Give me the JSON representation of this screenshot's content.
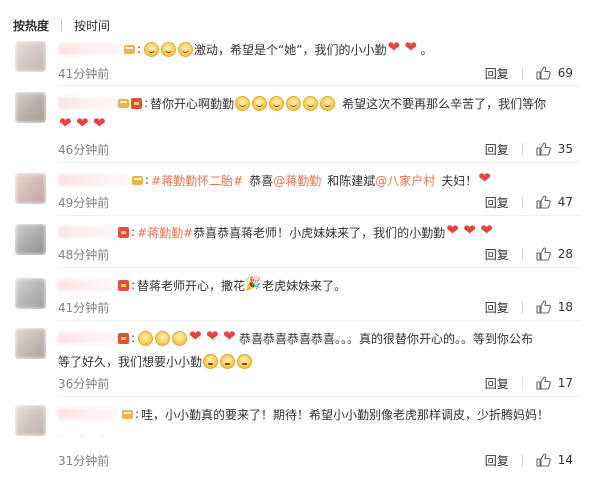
{
  "tabs": [
    {
      "label": "按热度",
      "active": true
    },
    {
      "label": "按时间",
      "active": false
    }
  ],
  "reply_label": "回复",
  "comments": [
    {
      "time": "41分钟前",
      "likes": "69",
      "t1": "激动，希望是个“她”，我们的小小勤",
      "t2": "。"
    },
    {
      "time": "46分钟前",
      "likes": "35",
      "t1": "替你开心啊勤勤",
      "t2": "希望这次不要再那么辛苦了，我们等你"
    },
    {
      "time": "49分钟前",
      "likes": "47",
      "tag": "#蒋勤勤怀二胎#",
      "t1": "恭喜",
      "mention1": "@蒋勤勤",
      "t2": "和陈建斌",
      "mention2": "@八家户村",
      "t3": "夫妇！"
    },
    {
      "time": "48分钟前",
      "likes": "28",
      "tag": "#蒋勤勤#",
      "t1": "恭喜恭喜蒋老师！小虎妹妹来了，我们的小勤勤"
    },
    {
      "time": "41分钟前",
      "likes": "18",
      "t1": "替蒋老师开心，撒花",
      "t2": "老虎妹妹来了。"
    },
    {
      "time": "36分钟前",
      "likes": "17",
      "t1": "恭喜恭喜恭喜恭喜。。。真的很替你开心的。。等到你公布",
      "t2": "等了好久，我们想要小小勤"
    },
    {
      "time": "31分钟前",
      "likes": "14",
      "t1": "哇，小小勤真的要来了！期待！希望小小勤别像老虎那样调皮，少折腾妈妈！"
    }
  ]
}
